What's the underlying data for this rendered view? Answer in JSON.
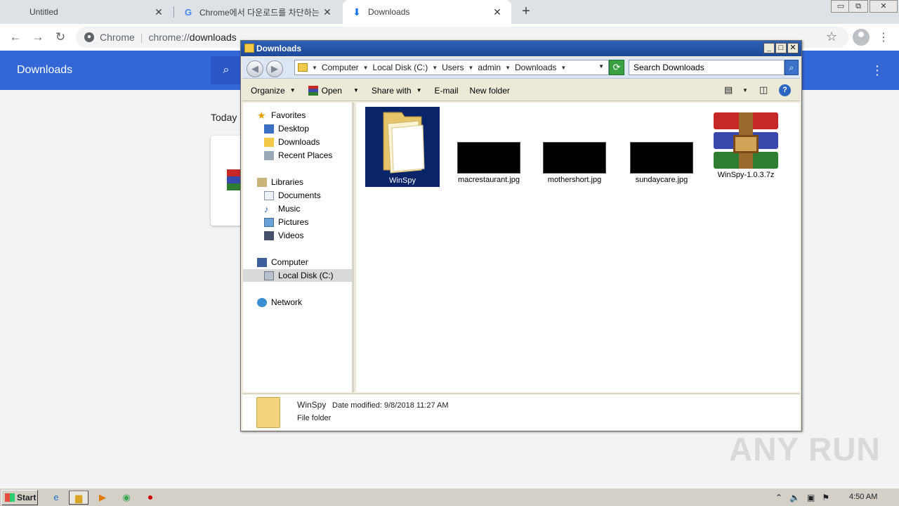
{
  "chrome": {
    "tabs": [
      {
        "label": "Untitled"
      },
      {
        "label": "Chrome에서 다운로드를 차단하는 정"
      },
      {
        "label": "Downloads"
      }
    ],
    "omnibox": {
      "site": "Chrome",
      "scheme": "chrome://",
      "path": "downloads"
    },
    "page": {
      "title": "Downloads",
      "section": "Today"
    }
  },
  "explorer": {
    "title": "Downloads",
    "breadcrumbs": [
      "Computer",
      "Local Disk (C:)",
      "Users",
      "admin",
      "Downloads"
    ],
    "search_placeholder": "Search Downloads",
    "commands": {
      "organize": "Organize",
      "open": "Open",
      "share": "Share with",
      "email": "E-mail",
      "new_folder": "New folder"
    },
    "nav": {
      "favorites": "Favorites",
      "desktop": "Desktop",
      "downloads": "Downloads",
      "recent": "Recent Places",
      "libraries": "Libraries",
      "documents": "Documents",
      "music": "Music",
      "pictures": "Pictures",
      "videos": "Videos",
      "computer": "Computer",
      "local_disk": "Local Disk (C:)",
      "network": "Network"
    },
    "files": [
      {
        "name": "WinSpy"
      },
      {
        "name": "macrestaurant.jpg"
      },
      {
        "name": "mothershort.jpg"
      },
      {
        "name": "sundaycare.jpg"
      },
      {
        "name": "WinSpy-1.0.3.7z"
      }
    ],
    "details": {
      "name": "WinSpy",
      "modified_label": "Date modified:",
      "modified_value": "9/8/2018 11:27 AM",
      "type": "File folder"
    }
  },
  "taskbar": {
    "start": "Start",
    "clock": "4:50 AM"
  },
  "watermark": "ANY RUN",
  "colors": {
    "chrome_blue": "#3367d6",
    "xp_title": "#2f62b5",
    "selection": "#0a246a"
  }
}
